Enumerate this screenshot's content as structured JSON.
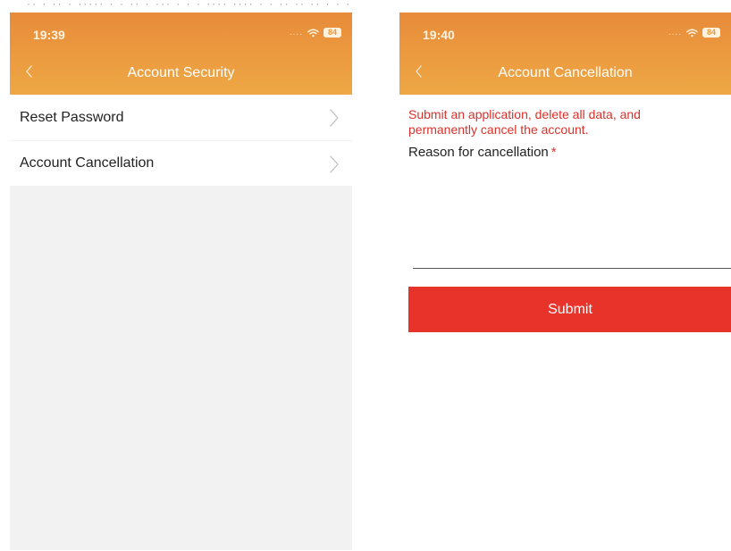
{
  "top_strip": {
    "text": "·· · ·· · ····· · · ·· · ··· · · · ···· ···· · · ·· ·· ·· · · ·"
  },
  "left_screen": {
    "status": {
      "time": "19:39",
      "battery": "84",
      "dots": "...."
    },
    "header": {
      "title": "Account Security",
      "back_icon": "chevron-left-icon"
    },
    "items": [
      {
        "label": "Reset Password",
        "icon": "chevron-right-icon"
      },
      {
        "label": "Account Cancellation",
        "icon": "chevron-right-icon"
      }
    ]
  },
  "right_screen": {
    "status": {
      "time": "19:40",
      "battery": "84",
      "dots": "...."
    },
    "header": {
      "title": "Account Cancellation",
      "back_icon": "chevron-left-icon"
    },
    "notice": "Submit an application, delete all data, and permanently cancel the account.",
    "reason_label": "Reason for cancellation",
    "required_mark": "*",
    "reason_value": "",
    "submit_label": "Submit"
  },
  "colors": {
    "header_gradient_start": "#e88b3a",
    "header_gradient_end": "#eea845",
    "notice_text": "#d9322b",
    "submit_button": "#e8332a",
    "page_background": "#f2f2f2"
  }
}
